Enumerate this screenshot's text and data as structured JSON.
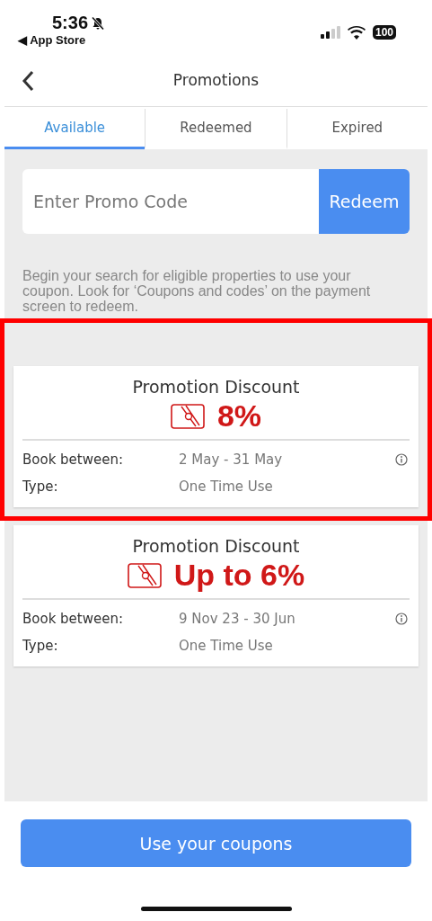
{
  "status_bar": {
    "time": "5:36",
    "back_app": "◀ App Store",
    "battery": "100"
  },
  "header": {
    "title": "Promotions"
  },
  "tabs": [
    {
      "label": "Available",
      "selected": true
    },
    {
      "label": "Redeemed",
      "selected": false
    },
    {
      "label": "Expired",
      "selected": false
    }
  ],
  "promo_code": {
    "placeholder": "Enter Promo Code",
    "button": "Redeem"
  },
  "info_text": "Begin your search for eligible properties to use your coupon. Look for ‘Coupons and codes’ on the payment screen to redeem.",
  "coupons": [
    {
      "title": "Promotion Discount",
      "amount": "8%",
      "highlighted": true,
      "rows": [
        {
          "label": "Book between:",
          "value": "2 May - 31 May",
          "info": true
        },
        {
          "label": "Type:",
          "value": "One Time Use",
          "info": false
        }
      ]
    },
    {
      "title": "Promotion Discount",
      "amount": "Up to 6%",
      "highlighted": false,
      "rows": [
        {
          "label": "Book between:",
          "value": "9 Nov 23 - 30 Jun",
          "info": true
        },
        {
          "label": "Type:",
          "value": "One Time Use",
          "info": false
        }
      ]
    }
  ],
  "footer_button": "Use your coupons"
}
